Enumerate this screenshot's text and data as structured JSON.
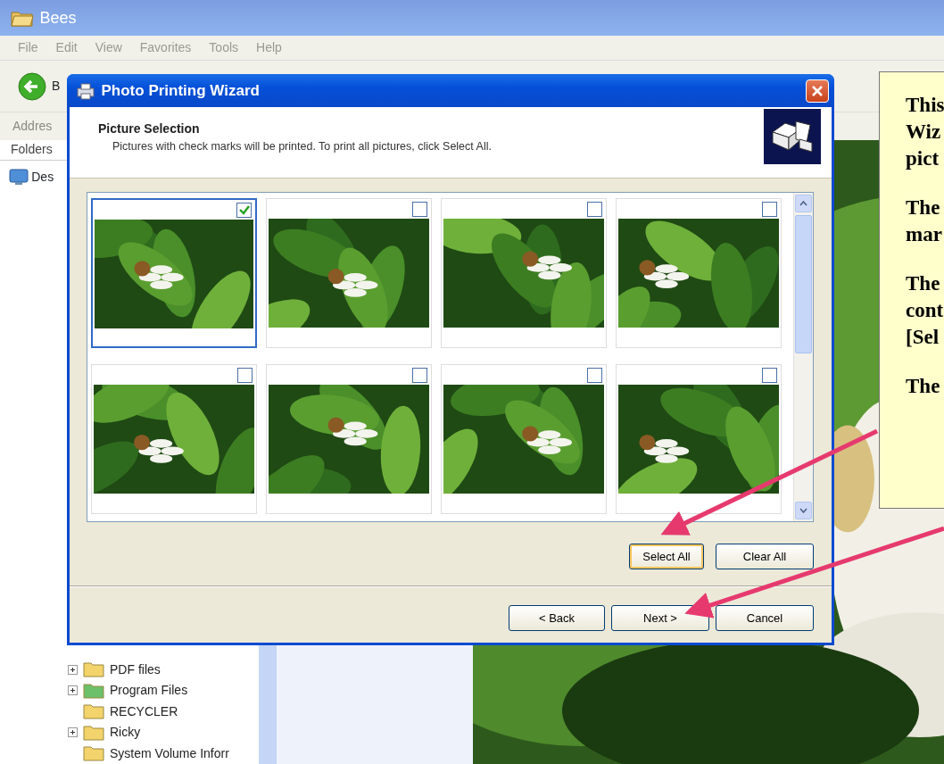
{
  "explorer": {
    "title": "Bees",
    "menu": [
      "File",
      "Edit",
      "View",
      "Favorites",
      "Tools",
      "Help"
    ],
    "back_label": "B",
    "address_label": "Addres",
    "folders_label": "Folders",
    "desktop_label": "Des",
    "tree": [
      {
        "label": "PDF files",
        "expandable": true,
        "color": "#f3d36b"
      },
      {
        "label": "Program Files",
        "expandable": true,
        "color": "#6cc06a"
      },
      {
        "label": "RECYCLER",
        "expandable": false,
        "color": "#f3d36b"
      },
      {
        "label": "Ricky",
        "expandable": true,
        "color": "#f3d36b"
      },
      {
        "label": "System Volume Inforr",
        "expandable": false,
        "color": "#f3d36b"
      }
    ]
  },
  "dialog": {
    "title": "Photo Printing Wizard",
    "heading": "Picture Selection",
    "subheading": "Pictures with check marks will be printed.  To print all pictures, click Select All.",
    "thumbnails": [
      {
        "checked": true,
        "selected": true
      },
      {
        "checked": false,
        "selected": false
      },
      {
        "checked": false,
        "selected": false
      },
      {
        "checked": false,
        "selected": false
      },
      {
        "checked": false,
        "selected": false
      },
      {
        "checked": false,
        "selected": false
      },
      {
        "checked": false,
        "selected": false
      },
      {
        "checked": false,
        "selected": false
      }
    ],
    "selection_buttons": [
      {
        "label": "Select All",
        "focused": true
      },
      {
        "label": "Clear All",
        "focused": false
      }
    ],
    "nav_buttons": [
      {
        "label": "< Back",
        "focused": false
      },
      {
        "label": "Next >",
        "focused": false
      },
      {
        "label": "Cancel",
        "focused": false
      }
    ]
  },
  "callout": {
    "paragraphs": [
      [
        "This",
        "Wiz",
        "pict"
      ],
      [
        "The",
        "mar"
      ],
      [
        "The",
        "cont",
        "[Sel"
      ],
      [
        "The"
      ]
    ]
  }
}
